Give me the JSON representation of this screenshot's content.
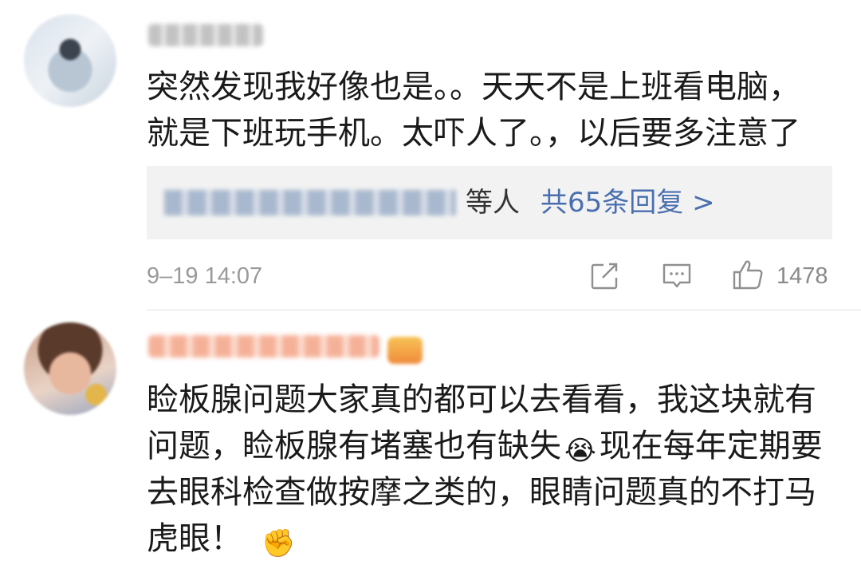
{
  "comments": [
    {
      "text_lines": [
        "突然发现我好像也是。。天天不是上班看电脑，",
        "就是下班玩手机。太吓人了。，以后要多注意了"
      ],
      "replies": {
        "suffix": "等人",
        "count_label": "共65条回复 >"
      },
      "timestamp": "9–19 14:07",
      "like_count": "1478"
    },
    {
      "text_lines": [
        "睑板腺问题大家真的都可以去看看，我这块就有",
        "问题，睑板腺有堵塞也有缺失",
        "现在每年定期要",
        "去眼科检查做按摩之类的，眼睛问题真的不打马",
        "虎眼！"
      ],
      "emojis": [
        "😭",
        "✊"
      ]
    }
  ],
  "icons": {
    "share": "share-icon",
    "comment": "comment-icon",
    "like": "thumbs-up-icon"
  },
  "colors": {
    "link": "#4a6fb0",
    "meta": "#9a9a9a",
    "reply_bg": "#f2f2f2"
  }
}
